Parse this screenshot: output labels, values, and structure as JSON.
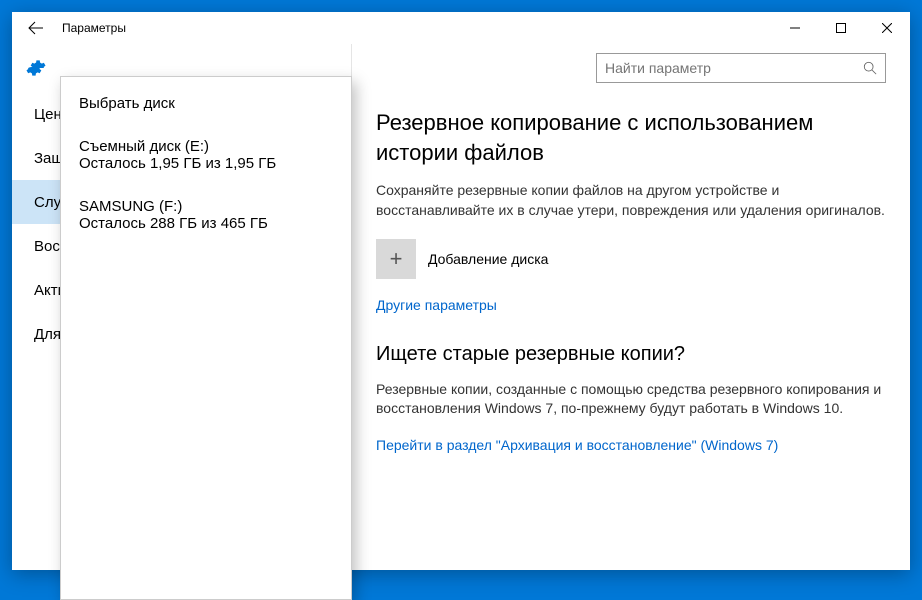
{
  "window": {
    "title": "Параметры"
  },
  "search": {
    "placeholder": "Найти параметр"
  },
  "sidebar": {
    "items": [
      {
        "label": "Центр"
      },
      {
        "label": "Защи"
      },
      {
        "label": "Служ",
        "active": true
      },
      {
        "label": "Восс"
      },
      {
        "label": "Акти"
      },
      {
        "label": "Для р"
      }
    ]
  },
  "popup": {
    "title": "Выбрать диск",
    "disks": [
      {
        "name": "Съемный диск (E:)",
        "sub": "Осталось 1,95 ГБ из 1,95 ГБ"
      },
      {
        "name": "SAMSUNG (F:)",
        "sub": "Осталось 288 ГБ из 465 ГБ"
      }
    ]
  },
  "main": {
    "heading": "Резервное копирование с использованием истории файлов",
    "paragraph": "Сохраняйте резервные копии файлов на другом устройстве и восстанавливайте их в случае утери, повреждения или удаления оригиналов.",
    "add_label": "Добавление диска",
    "link1": "Другие параметры",
    "heading2": "Ищете старые резервные копии?",
    "paragraph2": "Резервные копии, созданные с помощью средства резервного копирования и восстановления Windows 7, по-прежнему будут работать в Windows 10.",
    "link2": "Перейти в раздел \"Архивация и восстановление\" (Windows 7)"
  }
}
